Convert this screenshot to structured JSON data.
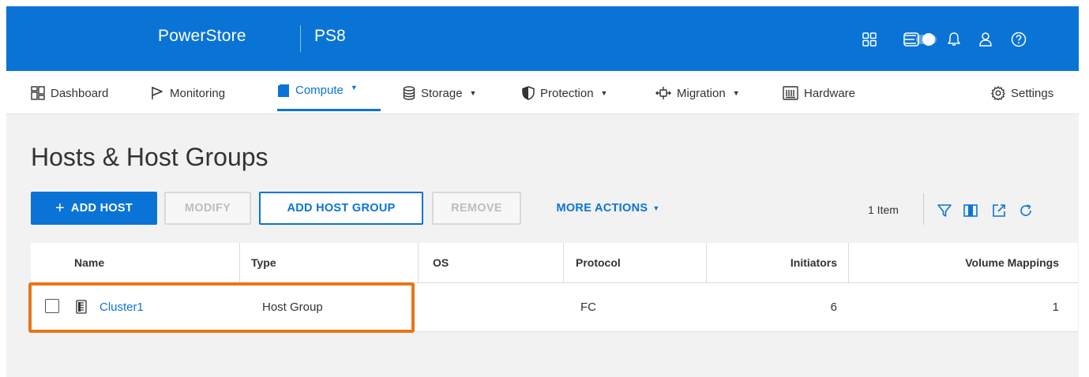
{
  "header": {
    "brand": "PowerStore",
    "system_name": "PS8",
    "bg_color": "#0a74d6",
    "icons": [
      "grid-apps-icon",
      "toggle-icon",
      "bell-icon",
      "user-icon",
      "help-icon"
    ]
  },
  "nav": {
    "dashboard": "Dashboard",
    "monitoring": "Monitoring",
    "compute": "Compute",
    "storage": "Storage",
    "protection": "Protection",
    "migration": "Migration",
    "hardware": "Hardware",
    "settings": "Settings",
    "active": "Compute"
  },
  "page": {
    "title": "Hosts & Host Groups"
  },
  "toolbar": {
    "add_host": "ADD HOST",
    "add_host_plus": "+",
    "modify": "MODIFY",
    "add_host_group": "ADD HOST GROUP",
    "remove": "REMOVE",
    "more_actions": "MORE ACTIONS",
    "item_count": "1 Item",
    "icons": [
      "filter-icon",
      "columns-icon",
      "export-icon",
      "refresh-icon"
    ]
  },
  "table": {
    "columns": [
      "Name",
      "Type",
      "OS",
      "Protocol",
      "Initiators",
      "Volume Mappings"
    ],
    "rows": [
      {
        "name": "Cluster1",
        "type": "Host Group",
        "os": "",
        "protocol": "FC",
        "initiators": "6",
        "volume_mappings": "1",
        "selected": false
      }
    ]
  },
  "colors": {
    "accent": "#0a74d6",
    "highlight": "#e8761a"
  }
}
